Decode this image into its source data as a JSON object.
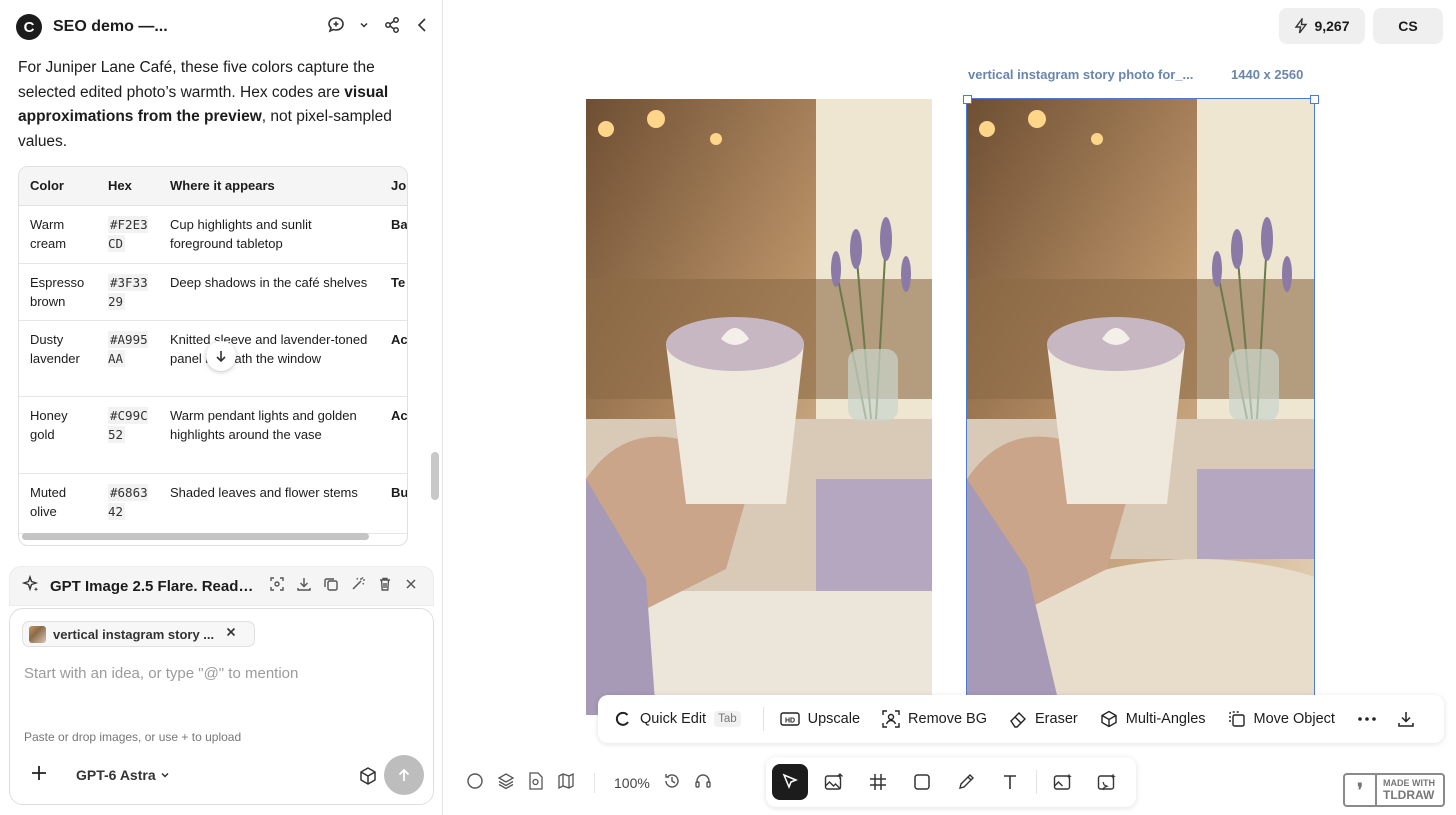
{
  "app": {
    "title": "SEO demo —...",
    "logo_letter": "C"
  },
  "chat": {
    "intro_start": "For Juniper Lane Café, these five colors capture the selected edited photo’s warmth. Hex codes are ",
    "intro_bold": "visual approximations from the preview",
    "intro_end": ", not pixel-sampled values.",
    "table": {
      "headers": [
        "Color",
        "Hex",
        "Where it appears",
        "Jo"
      ],
      "rows": [
        {
          "color": "Warm cream",
          "hex": "#F2E3CD",
          "where": "Cup highlights and sunlit foreground tabletop",
          "jo": "Ba ro"
        },
        {
          "color": "Espresso brown",
          "hex": "#3F3329",
          "where": "Deep shadows in the café shelves",
          "jo": "Te"
        },
        {
          "color": "Dusty lavender",
          "hex": "#A995AA",
          "where": "Knitted sleeve and lavender-toned panel beneath the window",
          "jo": "Ac t"
        },
        {
          "color": "Honey gold",
          "hex": "#C99C52",
          "where": "Warm pendant lights and golden highlights around the vase",
          "jo": "Ac t"
        },
        {
          "color": "Muted olive",
          "hex": "#686342",
          "where": "Shaded leaves and flower stems",
          "jo": "Bu n"
        }
      ]
    }
  },
  "status": {
    "label": "GPT Image 2.5 Flare. Ready ..."
  },
  "composer": {
    "chip_label": "vertical instagram story ...",
    "placeholder": "Start with an idea, or type \"@\" to mention",
    "hint": "Paste or drop images, or use + to upload",
    "model": "GPT-6 Astra"
  },
  "canvas": {
    "credits": "9,267",
    "user_initials": "CS",
    "selected_image_label": "vertical instagram story photo for_...",
    "selected_image_dims": "1440 x 2560",
    "zoom": "100%",
    "toolbar": {
      "quick_edit": "Quick Edit",
      "quick_edit_key": "Tab",
      "upscale": "Upscale",
      "remove_bg": "Remove BG",
      "eraser": "Eraser",
      "multi_angles": "Multi-Angles",
      "move_object": "Move Object"
    },
    "watermark": {
      "line1": "MADE WITH",
      "line2": "TLDRAW"
    }
  },
  "colors": {
    "accent": "#4a7bd0",
    "label_blue": "#6a86ad"
  }
}
